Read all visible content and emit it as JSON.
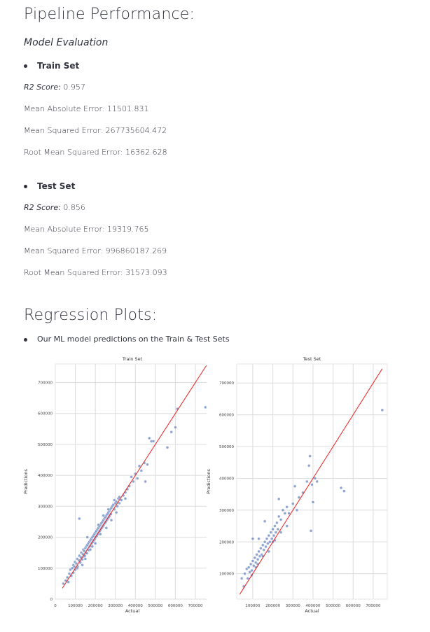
{
  "pipeline": {
    "title": "Pipeline Performance:",
    "subtitle": "Model Evaluation",
    "train": {
      "label": "Train Set",
      "r2_label": "R2 Score:",
      "r2_value": " 0.957",
      "mae": "Mean Absolute Error: 11501.831",
      "mse": "Mean Squared Error: 267735604.472",
      "rmse": "Root Mean Squared Error: 16362.628"
    },
    "test": {
      "label": "Test Set",
      "r2_label": "R2 Score:",
      "r2_value": " 0.856",
      "mae": "Mean Absolute Error: 19319.765",
      "mse": "Mean Squared Error: 996860187.269",
      "rmse": "Root Mean Squared Error: 31573.093"
    }
  },
  "regression": {
    "title": "Regression Plots:",
    "bullet": "Our ML model predictions on the Train & Test Sets"
  },
  "colors": {
    "point": "#6a87c2",
    "line": "#e8221d",
    "grid": "#dcdcdc"
  },
  "chart_data": [
    {
      "type": "scatter",
      "title": "Train Set",
      "xlabel": "Actual",
      "ylabel": "Predictions",
      "xlim": [
        0,
        770000
      ],
      "ylim": [
        0,
        760000
      ],
      "xticks": [
        100000,
        200000,
        300000,
        400000,
        500000,
        600000,
        700000
      ],
      "xtick_labels": [
        "100000",
        "200000",
        "300000",
        "400000",
        "500000",
        "600000",
        "700000"
      ],
      "xtick_zero": "0",
      "yticks": [
        0,
        100000,
        200000,
        300000,
        400000,
        500000,
        600000,
        700000
      ],
      "ytick_labels": [
        "0",
        "100000",
        "200000",
        "300000",
        "400000",
        "500000",
        "600000",
        "700000"
      ],
      "reference_line": [
        [
          35000,
          35000
        ],
        [
          755000,
          755000
        ]
      ],
      "grid": true,
      "points": [
        [
          40000,
          50000
        ],
        [
          52000,
          60000
        ],
        [
          60000,
          70000
        ],
        [
          70000,
          82000
        ],
        [
          75000,
          95000
        ],
        [
          80000,
          75000
        ],
        [
          85000,
          100000
        ],
        [
          90000,
          110000
        ],
        [
          95000,
          105000
        ],
        [
          98000,
          120000
        ],
        [
          100000,
          95000
        ],
        [
          105000,
          115000
        ],
        [
          110000,
          130000
        ],
        [
          112000,
          105000
        ],
        [
          118000,
          125000
        ],
        [
          120000,
          140000
        ],
        [
          125000,
          118000
        ],
        [
          128000,
          135000
        ],
        [
          130000,
          150000
        ],
        [
          135000,
          128000
        ],
        [
          138000,
          145000
        ],
        [
          140000,
          160000
        ],
        [
          142000,
          138000
        ],
        [
          145000,
          155000
        ],
        [
          148000,
          140000
        ],
        [
          150000,
          165000
        ],
        [
          152000,
          150000
        ],
        [
          155000,
          170000
        ],
        [
          158000,
          148000
        ],
        [
          160000,
          175000
        ],
        [
          162000,
          160000
        ],
        [
          165000,
          180000
        ],
        [
          168000,
          158000
        ],
        [
          170000,
          185000
        ],
        [
          172000,
          170000
        ],
        [
          175000,
          190000
        ],
        [
          178000,
          172000
        ],
        [
          180000,
          195000
        ],
        [
          182000,
          180000
        ],
        [
          185000,
          200000
        ],
        [
          188000,
          185000
        ],
        [
          190000,
          205000
        ],
        [
          192000,
          190000
        ],
        [
          195000,
          210000
        ],
        [
          198000,
          195000
        ],
        [
          200000,
          215000
        ],
        [
          202000,
          200000
        ],
        [
          205000,
          220000
        ],
        [
          208000,
          205000
        ],
        [
          210000,
          225000
        ],
        [
          212000,
          210000
        ],
        [
          215000,
          230000
        ],
        [
          218000,
          215000
        ],
        [
          220000,
          235000
        ],
        [
          222000,
          220000
        ],
        [
          225000,
          240000
        ],
        [
          228000,
          225000
        ],
        [
          230000,
          245000
        ],
        [
          232000,
          230000
        ],
        [
          235000,
          250000
        ],
        [
          238000,
          235000
        ],
        [
          240000,
          255000
        ],
        [
          242000,
          240000
        ],
        [
          245000,
          260000
        ],
        [
          248000,
          245000
        ],
        [
          250000,
          265000
        ],
        [
          252000,
          250000
        ],
        [
          255000,
          270000
        ],
        [
          258000,
          255000
        ],
        [
          260000,
          275000
        ],
        [
          262000,
          260000
        ],
        [
          265000,
          280000
        ],
        [
          268000,
          265000
        ],
        [
          270000,
          285000
        ],
        [
          272000,
          270000
        ],
        [
          275000,
          290000
        ],
        [
          278000,
          275000
        ],
        [
          280000,
          295000
        ],
        [
          285000,
          300000
        ],
        [
          290000,
          305000
        ],
        [
          295000,
          290000
        ],
        [
          300000,
          310000
        ],
        [
          305000,
          315000
        ],
        [
          310000,
          300000
        ],
        [
          315000,
          325000
        ],
        [
          320000,
          330000
        ],
        [
          330000,
          320000
        ],
        [
          340000,
          335000
        ],
        [
          350000,
          345000
        ],
        [
          360000,
          355000
        ],
        [
          370000,
          365000
        ],
        [
          380000,
          395000
        ],
        [
          390000,
          380000
        ],
        [
          400000,
          405000
        ],
        [
          410000,
          390000
        ],
        [
          420000,
          430000
        ],
        [
          430000,
          415000
        ],
        [
          445000,
          440000
        ],
        [
          450000,
          380000
        ],
        [
          460000,
          435000
        ],
        [
          470000,
          520000
        ],
        [
          480000,
          510000
        ],
        [
          490000,
          510000
        ],
        [
          560000,
          490000
        ],
        [
          580000,
          540000
        ],
        [
          600000,
          555000
        ],
        [
          610000,
          615000
        ],
        [
          750000,
          620000
        ],
        [
          120000,
          260000
        ],
        [
          90000,
          85000
        ],
        [
          65000,
          55000
        ],
        [
          110000,
          100000
        ],
        [
          160000,
          200000
        ],
        [
          200000,
          180000
        ],
        [
          240000,
          270000
        ],
        [
          280000,
          255000
        ],
        [
          320000,
          310000
        ],
        [
          350000,
          325000
        ],
        [
          175000,
          160000
        ],
        [
          215000,
          240000
        ],
        [
          255000,
          230000
        ],
        [
          295000,
          320000
        ],
        [
          135000,
          110000
        ],
        [
          150000,
          130000
        ],
        [
          185000,
          170000
        ],
        [
          225000,
          210000
        ],
        [
          265000,
          290000
        ],
        [
          305000,
          280000
        ]
      ]
    },
    {
      "type": "scatter",
      "title": "Test Set",
      "xlabel": "Actual",
      "ylabel": "Predictions",
      "xlim": [
        20000,
        770000
      ],
      "ylim": [
        20000,
        760000
      ],
      "xticks": [
        100000,
        200000,
        300000,
        400000,
        500000,
        600000,
        700000
      ],
      "xtick_labels": [
        "100000",
        "200000",
        "300000",
        "400000",
        "500000",
        "600000",
        "700000"
      ],
      "yticks": [
        100000,
        200000,
        300000,
        400000,
        500000,
        600000,
        700000
      ],
      "ytick_labels": [
        "100000",
        "200000",
        "300000",
        "400000",
        "500000",
        "600000",
        "700000"
      ],
      "reference_line": [
        [
          35000,
          35000
        ],
        [
          745000,
          745000
        ]
      ],
      "grid": true,
      "points": [
        [
          45000,
          85000
        ],
        [
          55000,
          60000
        ],
        [
          60000,
          100000
        ],
        [
          70000,
          115000
        ],
        [
          75000,
          85000
        ],
        [
          80000,
          120000
        ],
        [
          85000,
          105000
        ],
        [
          90000,
          130000
        ],
        [
          95000,
          110000
        ],
        [
          100000,
          140000
        ],
        [
          105000,
          125000
        ],
        [
          110000,
          150000
        ],
        [
          115000,
          135000
        ],
        [
          120000,
          160000
        ],
        [
          125000,
          145000
        ],
        [
          130000,
          170000
        ],
        [
          135000,
          155000
        ],
        [
          140000,
          180000
        ],
        [
          145000,
          160000
        ],
        [
          150000,
          190000
        ],
        [
          155000,
          175000
        ],
        [
          160000,
          200000
        ],
        [
          165000,
          185000
        ],
        [
          170000,
          210000
        ],
        [
          175000,
          195000
        ],
        [
          180000,
          220000
        ],
        [
          185000,
          200000
        ],
        [
          190000,
          230000
        ],
        [
          195000,
          210000
        ],
        [
          200000,
          240000
        ],
        [
          205000,
          220000
        ],
        [
          210000,
          250000
        ],
        [
          215000,
          230000
        ],
        [
          220000,
          260000
        ],
        [
          225000,
          240000
        ],
        [
          230000,
          280000
        ],
        [
          240000,
          270000
        ],
        [
          250000,
          300000
        ],
        [
          260000,
          290000
        ],
        [
          270000,
          310000
        ],
        [
          280000,
          290000
        ],
        [
          300000,
          320000
        ],
        [
          310000,
          375000
        ],
        [
          320000,
          300000
        ],
        [
          330000,
          340000
        ],
        [
          350000,
          355000
        ],
        [
          370000,
          390000
        ],
        [
          380000,
          440000
        ],
        [
          385000,
          470000
        ],
        [
          390000,
          235000
        ],
        [
          395000,
          380000
        ],
        [
          400000,
          325000
        ],
        [
          420000,
          390000
        ],
        [
          410000,
          400000
        ],
        [
          540000,
          370000
        ],
        [
          555000,
          360000
        ],
        [
          745000,
          615000
        ],
        [
          100000,
          210000
        ],
        [
          130000,
          210000
        ],
        [
          160000,
          265000
        ],
        [
          200000,
          200000
        ],
        [
          230000,
          335000
        ],
        [
          270000,
          250000
        ],
        [
          125000,
          130000
        ],
        [
          150000,
          155000
        ],
        [
          180000,
          170000
        ],
        [
          240000,
          230000
        ],
        [
          95000,
          95000
        ],
        [
          115000,
          120000
        ],
        [
          210000,
          205000
        ]
      ]
    }
  ]
}
